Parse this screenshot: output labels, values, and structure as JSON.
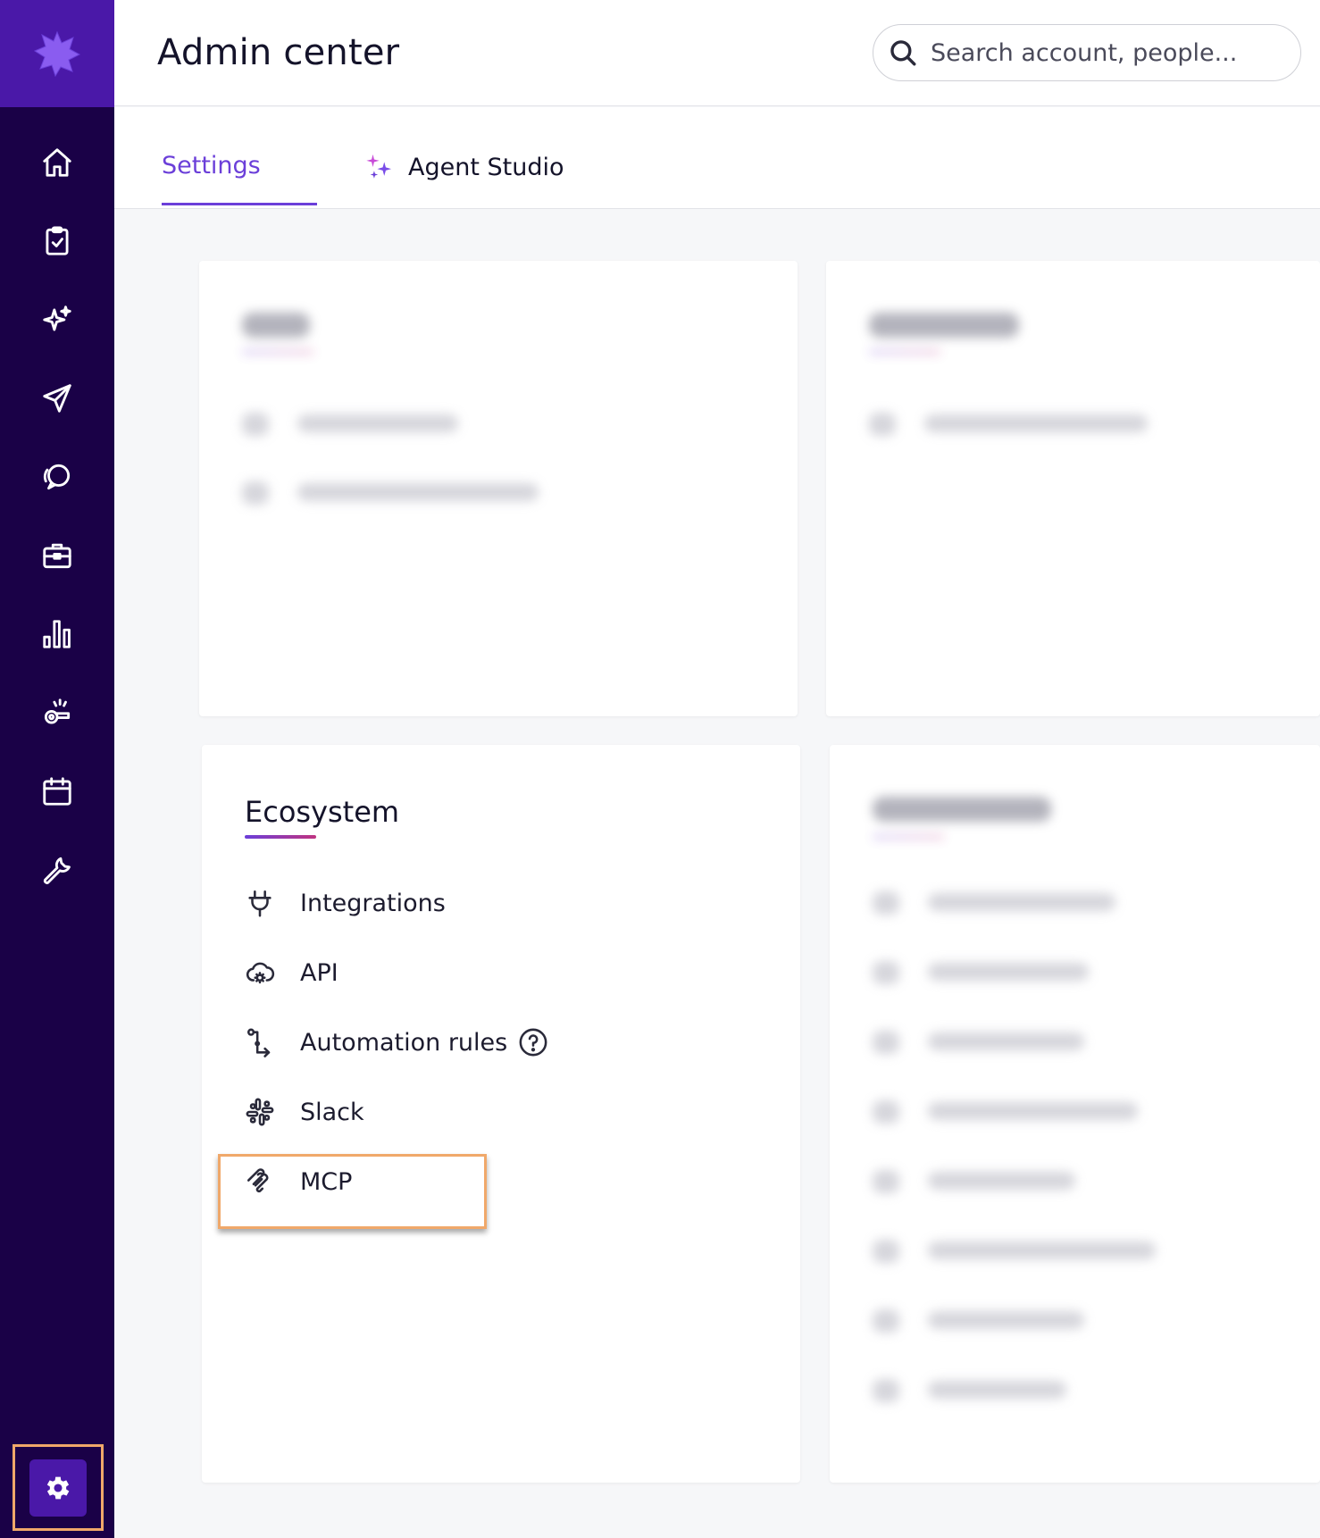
{
  "app": {
    "title": "Admin center",
    "accent_color": "#6b3fd9",
    "sidebar_bg": "#1a0147",
    "highlight_color": "#f0a86a"
  },
  "sidebar": {
    "logo_icon": "burst-logo-icon",
    "items": [
      {
        "icon": "home-icon"
      },
      {
        "icon": "clipboard-check-icon"
      },
      {
        "icon": "sparkle-icon"
      },
      {
        "icon": "send-icon"
      },
      {
        "icon": "chat-bubbles-icon"
      },
      {
        "icon": "briefcase-icon"
      },
      {
        "icon": "bar-chart-icon"
      },
      {
        "icon": "whistle-icon"
      },
      {
        "icon": "calendar-icon"
      },
      {
        "icon": "wrench-icon"
      }
    ],
    "settings_icon": "gear-icon"
  },
  "search": {
    "placeholder": "Search account, people..."
  },
  "tabs": [
    {
      "label": "Settings",
      "active": true
    },
    {
      "label": "Agent Studio",
      "active": false
    }
  ],
  "cards": {
    "ecosystem": {
      "title": "Ecosystem",
      "items": [
        {
          "label": "Integrations",
          "icon": "plug-icon"
        },
        {
          "label": "API",
          "icon": "cloud-gear-icon"
        },
        {
          "label": "Automation rules",
          "icon": "flow-icon",
          "help": true
        },
        {
          "label": "Slack",
          "icon": "slack-icon"
        },
        {
          "label": "MCP",
          "icon": "mcp-icon",
          "highlighted": true
        }
      ]
    }
  }
}
